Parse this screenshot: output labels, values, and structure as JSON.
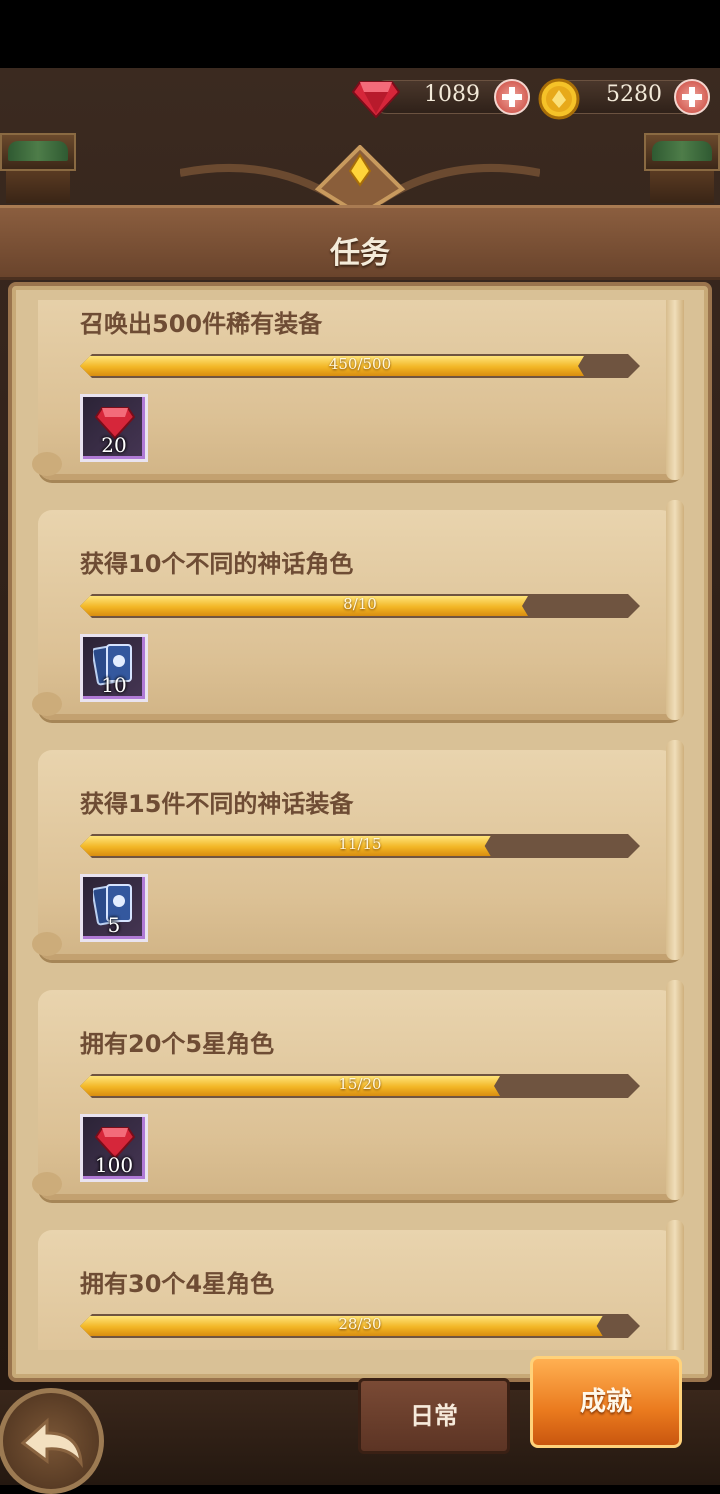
{
  "currency": {
    "gems": "1089",
    "coins": "5280"
  },
  "header": {
    "title": "任务"
  },
  "tasks": [
    {
      "title": "召唤出500件稀有装备",
      "progress_text": "450/500",
      "progress": 0.9,
      "reward_type": "gem-icon",
      "reward_amount": "20"
    },
    {
      "title": "获得10个不同的神话角色",
      "progress_text": "8/10",
      "progress": 0.8,
      "reward_type": "cards-icon",
      "reward_amount": "10"
    },
    {
      "title": "获得15件不同的神话装备",
      "progress_text": "11/15",
      "progress": 0.7333,
      "reward_type": "cards-icon",
      "reward_amount": "5"
    },
    {
      "title": "拥有20个5星角色",
      "progress_text": "15/20",
      "progress": 0.75,
      "reward_type": "gem-icon",
      "reward_amount": "100"
    },
    {
      "title": "拥有30个4星角色",
      "progress_text": "28/30",
      "progress": 0.9333,
      "reward_type": "gem-icon",
      "reward_amount": ""
    }
  ],
  "tabs": {
    "daily": "日常",
    "achievement": "成就"
  }
}
